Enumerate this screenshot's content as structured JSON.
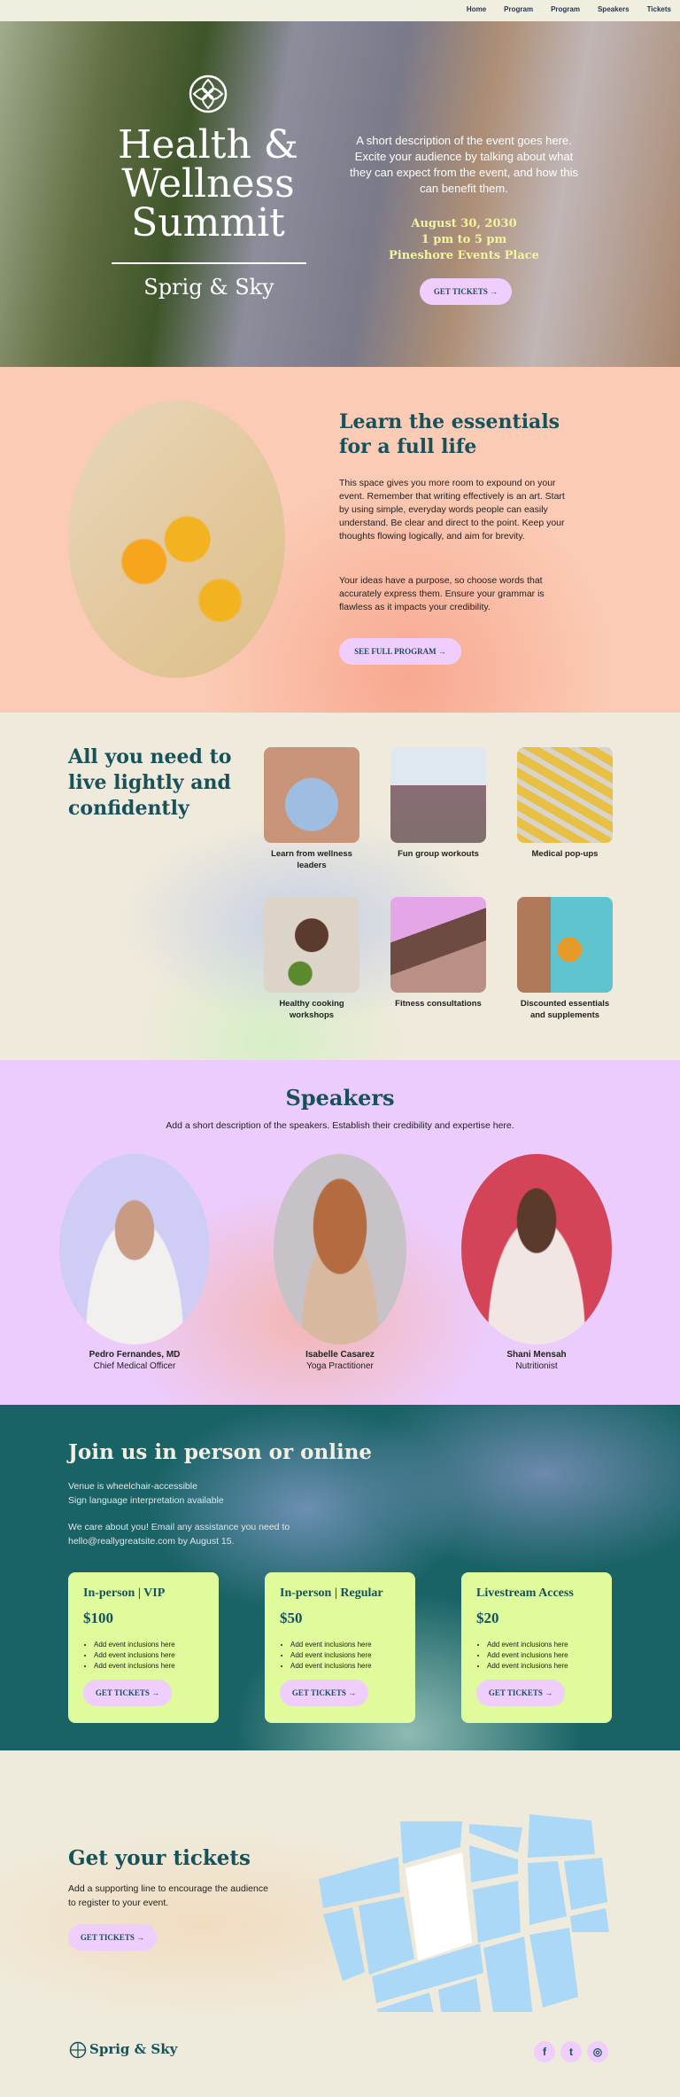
{
  "nav": [
    "Home",
    "Program",
    "Program",
    "Speakers",
    "Tickets"
  ],
  "hero": {
    "title_lines": [
      "Health &",
      "Wellness",
      "Summit"
    ],
    "brand": "Sprig & Sky",
    "description": "A short description of the event goes here. Excite your audience by talking about what they can expect from the event, and how this can benefit them.",
    "date": "August 30, 2030",
    "time": "1 pm to 5 pm",
    "venue": "Pineshore Events Place",
    "cta": "GET TICKETS →"
  },
  "essentials": {
    "title": "Learn the essentials for a full life",
    "p1": "This space gives you more room to expound on your event. Remember that writing effectively is an art. Start by using simple, everyday words people can easily understand. Be clear and direct to the point. Keep your thoughts flowing logically, and aim for brevity.",
    "p2": "Your ideas have a purpose, so choose words that accurately express them. Ensure your grammar is flawless as it impacts your credibility.",
    "cta": "SEE FULL PROGRAM →"
  },
  "features": {
    "title": "All you need to live lightly and confidently",
    "items": [
      "Learn from wellness leaders",
      "Fun group workouts",
      "Medical pop-ups",
      "Healthy cooking workshops",
      "Fitness consultations",
      "Discounted essentials and supplements"
    ]
  },
  "speakers": {
    "title": "Speakers",
    "subtitle": "Add a short description of the speakers. Establish their credibility and expertise here.",
    "people": [
      {
        "name": "Pedro Fernandes, MD",
        "role": "Chief Medical Officer"
      },
      {
        "name": "Isabelle Casarez",
        "role": "Yoga Practitioner"
      },
      {
        "name": "Shani Mensah",
        "role": "Nutritionist"
      }
    ]
  },
  "join": {
    "title": "Join us in person or online",
    "line1": "Venue is wheelchair-accessible",
    "line2": "Sign language interpretation available",
    "line3": "We care about you! Email any assistance you need to",
    "line4": "hello@reallygreatsite.com by August 15.",
    "tiers": [
      {
        "name": "In-person | VIP",
        "price": "$100"
      },
      {
        "name": "In-person | Regular",
        "price": "$50"
      },
      {
        "name": "Livestream Access",
        "price": "$20"
      }
    ],
    "inclusion": "Add event inclusions here",
    "cta": "GET TICKETS →"
  },
  "tickets": {
    "title": "Get your tickets",
    "text": "Add a supporting line to encourage the audience to register to your event.",
    "cta": "GET TICKETS →"
  },
  "footer": {
    "brand": "Sprig & Sky",
    "social": [
      "f",
      "t",
      "ig"
    ]
  },
  "colors": {
    "teal": "#17525b",
    "lavender": "#efcdfd",
    "lime": "#dffb9c",
    "peach": "#fbcbb5",
    "map_blue": "#acd8f8"
  }
}
